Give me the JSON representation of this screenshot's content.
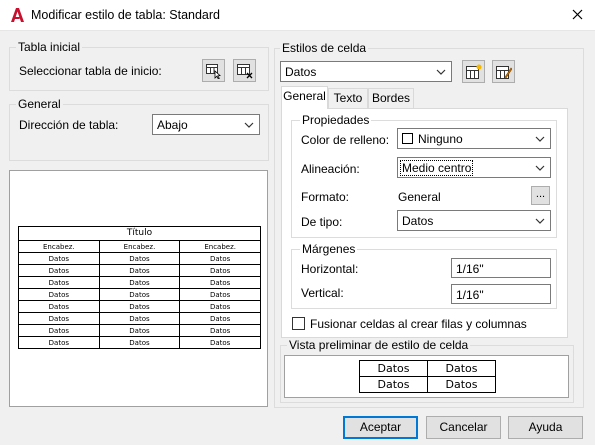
{
  "window": {
    "title": "Modificar estilo de tabla: Standard",
    "app_icon": "autocad-a-icon",
    "accent_color": "#c8102e"
  },
  "tabla_inicial": {
    "group_label": "Tabla inicial",
    "select_label": "Seleccionar tabla de inicio:"
  },
  "general": {
    "group_label": "General",
    "direction_label": "Dirección de tabla:",
    "direction_value": "Abajo"
  },
  "preview": {
    "title": "Título",
    "header": [
      "Encabez.",
      "Encabez.",
      "Encabez."
    ],
    "rows": [
      [
        "Datos",
        "Datos",
        "Datos"
      ],
      [
        "Datos",
        "Datos",
        "Datos"
      ],
      [
        "Datos",
        "Datos",
        "Datos"
      ],
      [
        "Datos",
        "Datos",
        "Datos"
      ],
      [
        "Datos",
        "Datos",
        "Datos"
      ],
      [
        "Datos",
        "Datos",
        "Datos"
      ],
      [
        "Datos",
        "Datos",
        "Datos"
      ],
      [
        "Datos",
        "Datos",
        "Datos"
      ]
    ]
  },
  "estilos_celda": {
    "group_label": "Estilos de celda",
    "selected": "Datos"
  },
  "tabs": [
    "General",
    "Texto",
    "Bordes"
  ],
  "active_tab": "General",
  "propiedades": {
    "group_label": "Propiedades",
    "fill_color_label": "Color de relleno:",
    "fill_color_value": "Ninguno",
    "alignment_label": "Alineación:",
    "alignment_value": "Medio centro",
    "format_label": "Formato:",
    "format_value": "General",
    "format_button": "...",
    "type_label": "De tipo:",
    "type_value": "Datos"
  },
  "margenes": {
    "group_label": "Márgenes",
    "horizontal_label": "Horizontal:",
    "horizontal_value": "1/16\"",
    "vertical_label": "Vertical:",
    "vertical_value": "1/16\""
  },
  "merge_checkbox_label": "Fusionar celdas al crear filas y columnas",
  "merge_checked": false,
  "cell_preview": {
    "group_label": "Vista preliminar de estilo de celda",
    "cells": [
      "Datos",
      "Datos",
      "Datos",
      "Datos"
    ]
  },
  "buttons": {
    "ok": "Aceptar",
    "cancel": "Cancelar",
    "help": "Ayuda"
  }
}
